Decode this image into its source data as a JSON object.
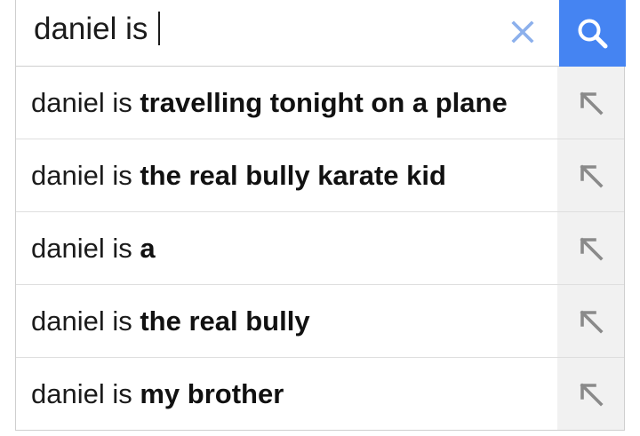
{
  "search": {
    "query": "daniel is ",
    "clear_icon": "close-icon",
    "search_icon": "search-icon",
    "accent_color": "#4584f2"
  },
  "suggestions": [
    {
      "prefix": "daniel is ",
      "completion": "travelling tonight on a plane"
    },
    {
      "prefix": "daniel is ",
      "completion": "the real bully karate kid"
    },
    {
      "prefix": "daniel is ",
      "completion": "a"
    },
    {
      "prefix": "daniel is ",
      "completion": "the real bully"
    },
    {
      "prefix": "daniel is ",
      "completion": "my brother"
    }
  ],
  "suggestion_action_icon": "arrow-up-left-icon"
}
